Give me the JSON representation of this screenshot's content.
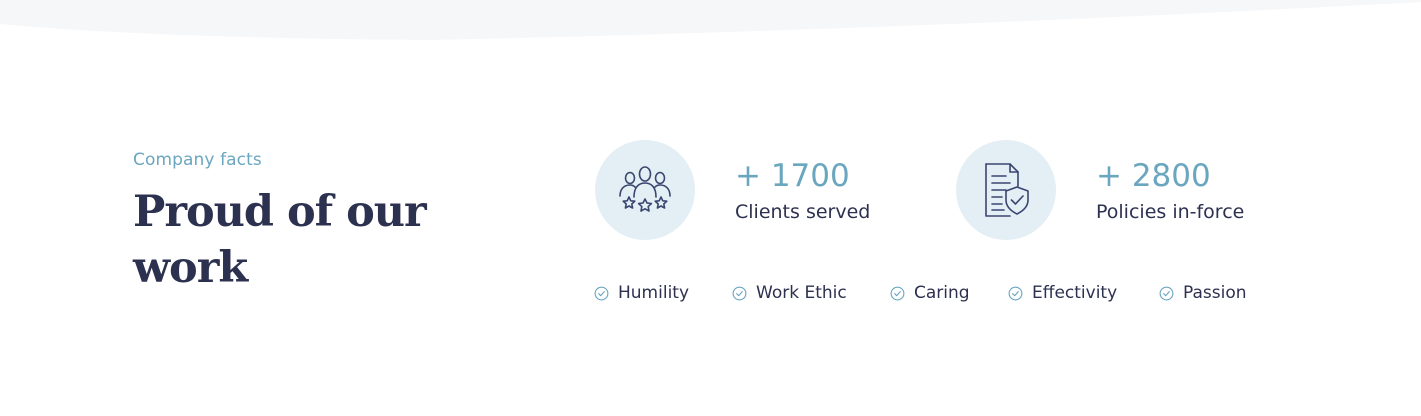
{
  "section": {
    "eyebrow": "Company facts",
    "headline": "Proud of our work"
  },
  "facts": [
    {
      "icon": "team-stars-icon",
      "number": "+ 1700",
      "label": "Clients served"
    },
    {
      "icon": "policy-shield-icon",
      "number": "+ 2800",
      "label": "Policies in-force"
    }
  ],
  "values": [
    {
      "icon": "check-circle-icon",
      "label": "Humility"
    },
    {
      "icon": "check-circle-icon",
      "label": "Work Ethic"
    },
    {
      "icon": "check-circle-icon",
      "label": "Caring"
    },
    {
      "icon": "check-circle-icon",
      "label": "Effectivity"
    },
    {
      "icon": "check-circle-icon",
      "label": "Passion"
    }
  ],
  "colors": {
    "accent": "#6ba6bf",
    "text_dark": "#2c3150",
    "icon_bg": "#e3eff4",
    "wave_bg": "#f5f7f9"
  }
}
